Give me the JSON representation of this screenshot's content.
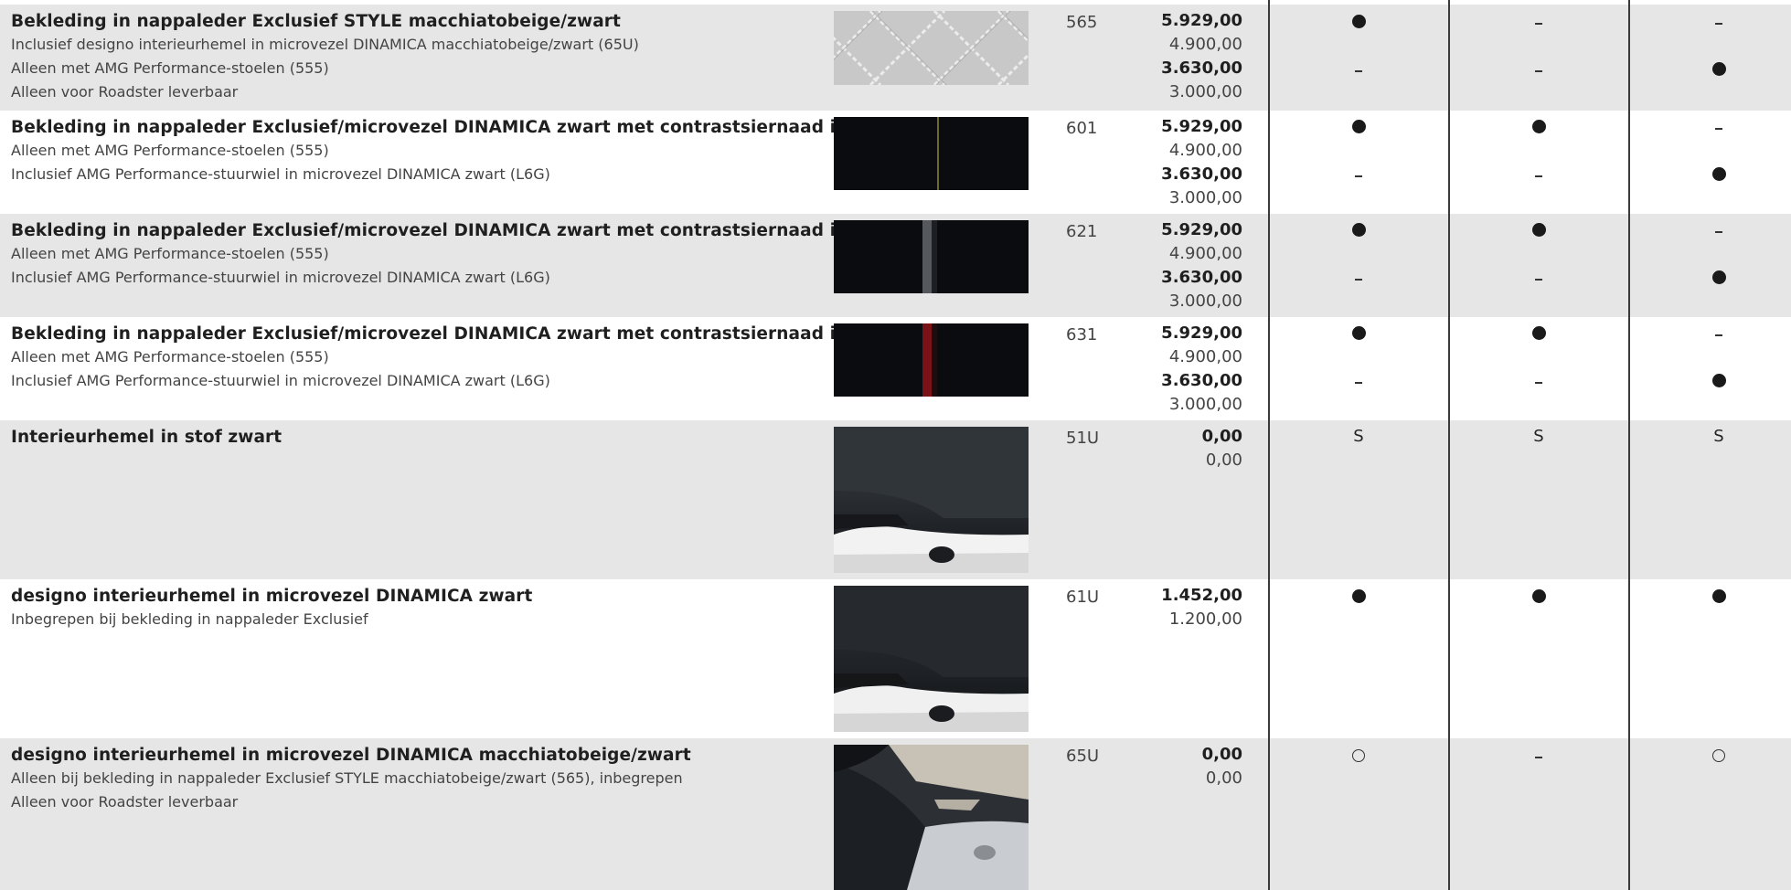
{
  "rows": [
    {
      "title": "Bekleding in nappaleder Exclusief STYLE macchiatobeige/zwart",
      "notes": [
        "Inclusief designo interieurhemel in microvezel DINAMICA macchiatobeige/zwart (65U)",
        "Alleen met AMG Performance-stoelen (555)",
        "Alleen voor Roadster leverbaar"
      ],
      "swatch": "quilted-leather-swatch",
      "code": "565",
      "prices": [
        "5.929,00",
        "4.900,00",
        "3.630,00",
        "3.000,00"
      ],
      "marks_top": [
        "dot",
        "dash",
        "dash"
      ],
      "marks_bottom": [
        "dash",
        "dash",
        "dot"
      ]
    },
    {
      "title": "Bekleding in nappaleder Exclusief/microvezel DINAMICA zwart met contrastsiernaad in geel",
      "notes": [
        "Alleen met AMG Performance-stoelen (555)",
        "Inclusief AMG Performance-stuurwiel in microvezel DINAMICA zwart (L6G)"
      ],
      "swatch": "black-yellow-stitch-swatch",
      "code": "601",
      "prices": [
        "5.929,00",
        "4.900,00",
        "3.630,00",
        "3.000,00"
      ],
      "marks_top": [
        "dot",
        "dot",
        "dash"
      ],
      "marks_bottom": [
        "dash",
        "dash",
        "dot"
      ]
    },
    {
      "title": "Bekleding in nappaleder Exclusief/microvezel DINAMICA zwart met contrastsiernaad in grijs",
      "notes": [
        "Alleen met AMG Performance-stoelen (555)",
        "Inclusief AMG Performance-stuurwiel in microvezel DINAMICA zwart (L6G)"
      ],
      "swatch": "black-grey-stitch-swatch",
      "code": "621",
      "prices": [
        "5.929,00",
        "4.900,00",
        "3.630,00",
        "3.000,00"
      ],
      "marks_top": [
        "dot",
        "dot",
        "dash"
      ],
      "marks_bottom": [
        "dash",
        "dash",
        "dot"
      ]
    },
    {
      "title": "Bekleding in nappaleder Exclusief/microvezel DINAMICA zwart met contrastsiernaad in rood",
      "notes": [
        "Alleen met AMG Performance-stoelen (555)",
        "Inclusief AMG Performance-stuurwiel in microvezel DINAMICA zwart (L6G)"
      ],
      "swatch": "black-red-stitch-swatch",
      "code": "631",
      "prices": [
        "5.929,00",
        "4.900,00",
        "3.630,00",
        "3.000,00"
      ],
      "marks_top": [
        "dot",
        "dot",
        "dash"
      ],
      "marks_bottom": [
        "dash",
        "dash",
        "dot"
      ]
    },
    {
      "title": "Interieurhemel in stof zwart",
      "notes": [],
      "swatch": "black-headliner-photo",
      "code": "51U",
      "prices": [
        "0,00",
        "0,00"
      ],
      "marks_top": [
        "S",
        "S",
        "S"
      ],
      "marks_bottom": []
    },
    {
      "title": "designo interieurhemel in microvezel DINAMICA zwart",
      "notes": [
        "Inbegrepen bij bekleding in nappaleder Exclusief"
      ],
      "swatch": "dinamica-black-headliner-photo",
      "code": "61U",
      "prices": [
        "1.452,00",
        "1.200,00"
      ],
      "marks_top": [
        "dot",
        "dot",
        "dot"
      ],
      "marks_bottom": []
    },
    {
      "title": "designo interieurhemel in microvezel DINAMICA macchiatobeige/zwart",
      "notes": [
        "Alleen bij bekleding in nappaleder Exclusief STYLE macchiatobeige/zwart (565), inbegrepen",
        "Alleen voor Roadster leverbaar"
      ],
      "swatch": "beige-headliner-photo",
      "code": "65U",
      "prices": [
        "0,00",
        "0,00"
      ],
      "marks_top": [
        "ring",
        "dash",
        "ring"
      ],
      "marks_bottom": []
    }
  ]
}
